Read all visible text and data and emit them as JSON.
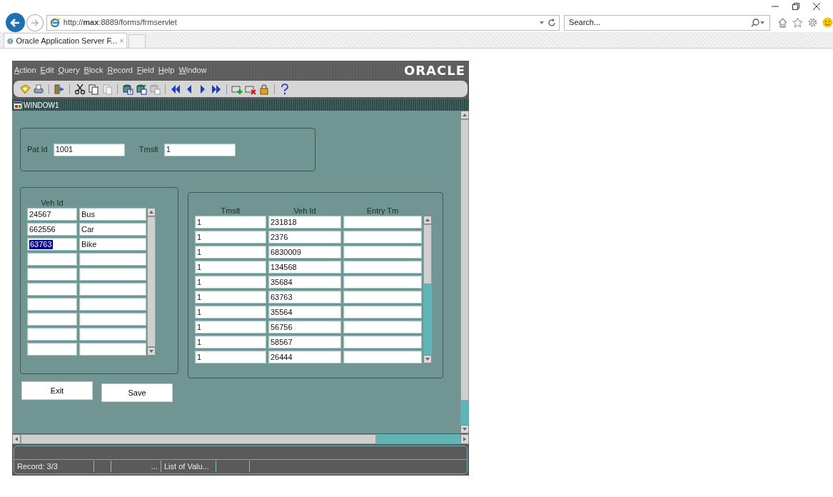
{
  "browser": {
    "address": "http://**max**:8889/forms/frmservlet",
    "search": {
      "placeholder": "Search..."
    },
    "tabs": [
      {
        "label": "Oracle Application Server F...",
        "selected": true
      }
    ]
  },
  "menu": [
    "Action",
    "Edit",
    "Query",
    "Block",
    "Record",
    "Field",
    "Help",
    "Window"
  ],
  "logo": "ORACLE",
  "window": {
    "title": "WINDOW1"
  },
  "header_block": {
    "fields": [
      {
        "label": "Pat Id",
        "value": "1001"
      },
      {
        "label": "Tmslt",
        "value": "1"
      }
    ]
  },
  "vehicle_block": {
    "columns": [
      "Veh Id"
    ],
    "rows": [
      {
        "veh_id": "24567",
        "type": "Bus",
        "selected": false
      },
      {
        "veh_id": "662556",
        "type": "Car",
        "selected": false
      },
      {
        "veh_id": "63763",
        "type": "Bike",
        "selected": true
      },
      {
        "selected": false
      },
      {
        "selected": false
      },
      {
        "selected": false
      },
      {
        "selected": false
      },
      {
        "selected": false
      },
      {
        "selected": false
      },
      {
        "selected": false
      }
    ]
  },
  "entry_block": {
    "columns": [
      "Tmslt",
      "Veh Id",
      "Entry Tm"
    ],
    "rows": [
      {
        "tmslt": "1",
        "veh_id": "231818"
      },
      {
        "tmslt": "1",
        "veh_id": "2376"
      },
      {
        "tmslt": "1",
        "veh_id": "6830009"
      },
      {
        "tmslt": "1",
        "veh_id": "134568"
      },
      {
        "tmslt": "1",
        "veh_id": "35684"
      },
      {
        "tmslt": "1",
        "veh_id": "63763"
      },
      {
        "tmslt": "1",
        "veh_id": "35564"
      },
      {
        "tmslt": "1",
        "veh_id": "56756"
      },
      {
        "tmslt": "1",
        "veh_id": "58567"
      },
      {
        "tmslt": "1",
        "veh_id": "26444"
      }
    ]
  },
  "buttons": [
    "Exit",
    "Save"
  ],
  "status_bar": [
    "Record: 3/3",
    "...",
    "List of Valu..."
  ]
}
